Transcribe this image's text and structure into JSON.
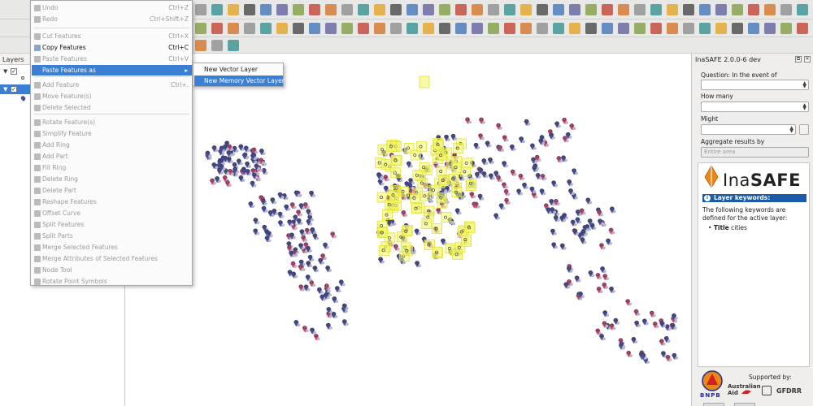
{
  "context_menu": {
    "items": [
      {
        "label": "Undo",
        "shortcut": "Ctrl+Z",
        "enabled": false
      },
      {
        "label": "Redo",
        "shortcut": "Ctrl+Shift+Z",
        "enabled": false
      },
      {
        "label": "Cut Features",
        "shortcut": "Ctrl+X",
        "enabled": false
      },
      {
        "label": "Copy Features",
        "shortcut": "Ctrl+C",
        "enabled": true
      },
      {
        "label": "Paste Features",
        "shortcut": "Ctrl+V",
        "enabled": false
      },
      {
        "label": "Paste Features as",
        "shortcut": "",
        "enabled": true
      },
      {
        "label": "Add Feature",
        "shortcut": "Ctrl+.",
        "enabled": false
      },
      {
        "label": "Move Feature(s)",
        "shortcut": "",
        "enabled": false
      },
      {
        "label": "Delete Selected",
        "shortcut": "",
        "enabled": false
      },
      {
        "label": "Rotate Feature(s)",
        "shortcut": "",
        "enabled": false
      },
      {
        "label": "Simplify Feature",
        "shortcut": "",
        "enabled": false
      },
      {
        "label": "Add Ring",
        "shortcut": "",
        "enabled": false
      },
      {
        "label": "Add Part",
        "shortcut": "",
        "enabled": false
      },
      {
        "label": "Fill Ring",
        "shortcut": "",
        "enabled": false
      },
      {
        "label": "Delete Ring",
        "shortcut": "",
        "enabled": false
      },
      {
        "label": "Delete Part",
        "shortcut": "",
        "enabled": false
      },
      {
        "label": "Reshape Features",
        "shortcut": "",
        "enabled": false
      },
      {
        "label": "Offset Curve",
        "shortcut": "",
        "enabled": false
      },
      {
        "label": "Split Features",
        "shortcut": "",
        "enabled": false
      },
      {
        "label": "Split Parts",
        "shortcut": "",
        "enabled": false
      },
      {
        "label": "Merge Selected Features",
        "shortcut": "",
        "enabled": false
      },
      {
        "label": "Merge Attributes of Selected Features",
        "shortcut": "",
        "enabled": false
      },
      {
        "label": "Node Tool",
        "shortcut": "",
        "enabled": false
      },
      {
        "label": "Rotate Point Symbols",
        "shortcut": "",
        "enabled": false
      }
    ],
    "submenu": [
      "New Vector Layer",
      "New Memory Vector Layer"
    ]
  },
  "layers_panel": {
    "title": "Layers"
  },
  "dock": {
    "title": "InaSAFE 2.0.0-6 dev",
    "question_label": "Question: In the event of",
    "how_many_label": "How many",
    "might_label": "Might",
    "aggregate_label": "Aggregate results by",
    "aggregate_value": "Entire area",
    "logo_text_1": "Ina",
    "logo_text_2": "SAFE",
    "kw_title": "Layer keywords:",
    "kw_desc": "The following keywords are defined for the active layer:",
    "kw_key": "Title",
    "kw_value": "cities",
    "supported_by": "Supported by:",
    "sponsor_bnpb": "BNPB",
    "sponsor_aus_1": "Australian",
    "sponsor_aus_2": "Aid",
    "sponsor_gfdrr": "GFDRR",
    "close_glyph": "✕",
    "float_glyph": "⧉"
  },
  "colors": {
    "menu_highlight": "#3b7fd4",
    "selection_yellow": "#f0f545",
    "marker_purple": "#4a4f9a",
    "kw_blue": "#1a5caa",
    "logo_orange": "#e8881a"
  }
}
